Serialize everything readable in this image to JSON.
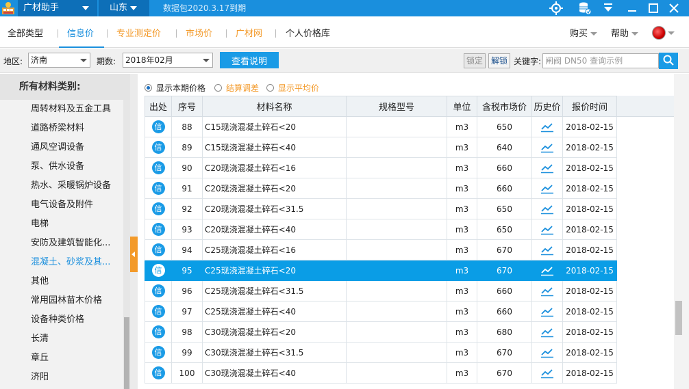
{
  "titlebar": {
    "app_title": "广材助手",
    "region": "山东",
    "expire_text": "数据包2020.3.17到期"
  },
  "menu": {
    "items": [
      "全部类型",
      "信息价",
      "专业测定价",
      "市场价",
      "广材网",
      "个人价格库"
    ],
    "active_index": 1,
    "buy": "购买",
    "help": "帮助"
  },
  "filter": {
    "region_label": "地区:",
    "region_value": "济南",
    "period_label": "期数:",
    "period_value": "2018年02月",
    "explain_button": "查看说明",
    "lock_label": "锁定",
    "unlock_label": "解锁",
    "keyword_label": "关键字:",
    "keyword_placeholder": "闸阀 DN50 查询示例"
  },
  "sidebar": {
    "title": "所有材料类别:",
    "items": [
      "周转材料及五金工具",
      "道路桥梁材料",
      "通风空调设备",
      "泵、供水设备",
      "热水、采暖锅炉设备",
      "电气设备及附件",
      "电梯",
      "安防及建筑智能化...",
      "混凝土、砂浆及其...",
      "其他",
      "常用园林苗木价格",
      "设备种类价格",
      "长清",
      "章丘",
      "济阳"
    ],
    "active_index": 8
  },
  "radios": {
    "show_current": "显示本期价格",
    "settlement": "结算调差",
    "show_average": "显示平均价"
  },
  "table": {
    "headers": [
      "出处",
      "序号",
      "材料名称",
      "规格型号",
      "单位",
      "含税市场价",
      "历史价",
      "报价时间"
    ],
    "source_badge": "信",
    "rows": [
      {
        "no": "88",
        "name": "C15现浇混凝土碎石<20",
        "spec": "",
        "unit": "m3",
        "price": "650",
        "date": "2018-02-15"
      },
      {
        "no": "89",
        "name": "C15现浇混凝土碎石<40",
        "spec": "",
        "unit": "m3",
        "price": "640",
        "date": "2018-02-15"
      },
      {
        "no": "90",
        "name": "C20现浇混凝土碎石<16",
        "spec": "",
        "unit": "m3",
        "price": "660",
        "date": "2018-02-15"
      },
      {
        "no": "91",
        "name": "C20现浇混凝土碎石<20",
        "spec": "",
        "unit": "m3",
        "price": "660",
        "date": "2018-02-15"
      },
      {
        "no": "92",
        "name": "C20现浇混凝土碎石<31.5",
        "spec": "",
        "unit": "m3",
        "price": "650",
        "date": "2018-02-15"
      },
      {
        "no": "93",
        "name": "C20现浇混凝土碎石<40",
        "spec": "",
        "unit": "m3",
        "price": "650",
        "date": "2018-02-15"
      },
      {
        "no": "94",
        "name": "C25现浇混凝土碎石<16",
        "spec": "",
        "unit": "m3",
        "price": "670",
        "date": "2018-02-15"
      },
      {
        "no": "95",
        "name": "C25现浇混凝土碎石<20",
        "spec": "",
        "unit": "m3",
        "price": "670",
        "date": "2018-02-15",
        "selected": true
      },
      {
        "no": "96",
        "name": "C25现浇混凝土碎石<31.5",
        "spec": "",
        "unit": "m3",
        "price": "660",
        "date": "2018-02-15"
      },
      {
        "no": "97",
        "name": "C25现浇混凝土碎石<40",
        "spec": "",
        "unit": "m3",
        "price": "660",
        "date": "2018-02-15"
      },
      {
        "no": "98",
        "name": "C30现浇混凝土碎石<20",
        "spec": "",
        "unit": "m3",
        "price": "680",
        "date": "2018-02-15"
      },
      {
        "no": "99",
        "name": "C30现浇混凝土碎石<31.5",
        "spec": "",
        "unit": "m3",
        "price": "670",
        "date": "2018-02-15"
      },
      {
        "no": "100",
        "name": "C30现浇混凝土碎石<40",
        "spec": "",
        "unit": "m3",
        "price": "670",
        "date": "2018-02-15"
      }
    ]
  },
  "colors": {
    "titlebar": "#1a8fdd",
    "accent": "#1a9be6",
    "selected_row": "#0a9de6",
    "orange_menu": "#f39a2a"
  },
  "icons": {
    "titlebar": [
      "locate-icon",
      "database-icon",
      "download-icon",
      "minimize-icon",
      "maximize-icon",
      "close-icon"
    ],
    "row_history": "trend-chart-icon",
    "search": "search-icon"
  }
}
